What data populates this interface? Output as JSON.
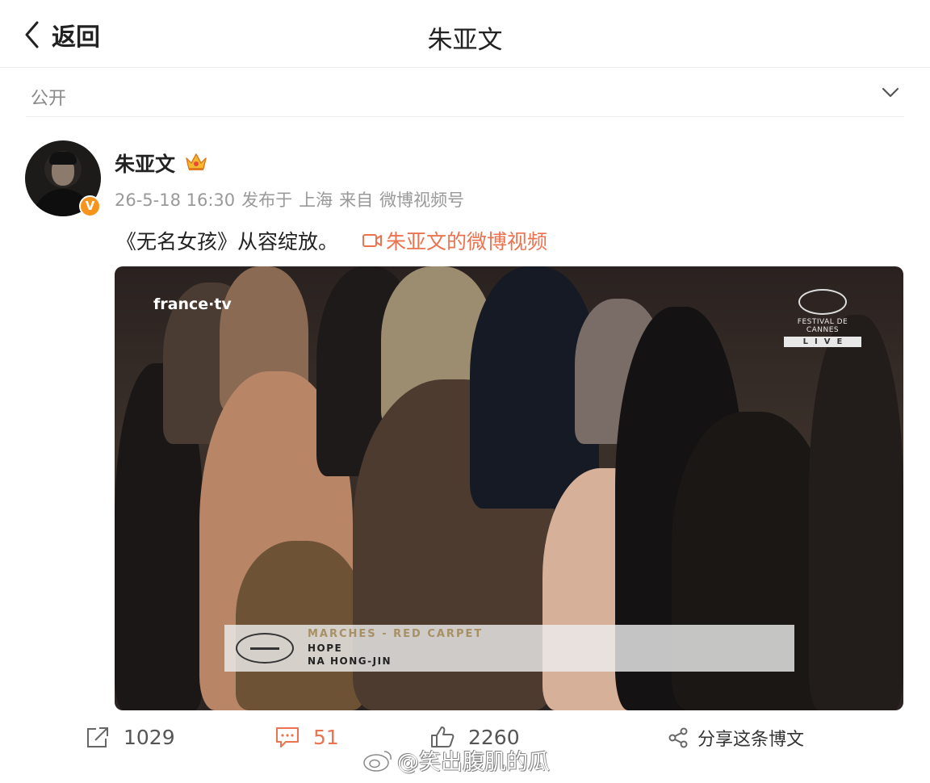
{
  "header": {
    "back_label": "返回",
    "title": "朱亚文"
  },
  "visibility": {
    "label": "公开"
  },
  "post": {
    "author": "朱亚文",
    "verified_badge": "V",
    "timestamp": "26-5-18 16:30",
    "location_prefix": "发布于",
    "location": "上海",
    "source_prefix": "来自",
    "source": "微博视频号",
    "text": "《无名女孩》从容绽放。",
    "video_link_label": "朱亚文的微博视频"
  },
  "video": {
    "channel_logo": "france·tv",
    "festival_name": "FESTIVAL DE CANNES",
    "festival_live": "LIVE",
    "lower_third_line1": "MARCHES - RED CARPET",
    "lower_third_line2": "HOPE",
    "lower_third_line3": "NA HONG-JIN"
  },
  "actions": {
    "repost_count": "1029",
    "comment_count": "51",
    "like_count": "2260",
    "share_label": "分享这条博文"
  },
  "watermark": {
    "text": "@笑出腹肌的瓜"
  },
  "colors": {
    "accent": "#eb7350",
    "verified": "#f7941d",
    "muted_text": "#999999"
  },
  "icons": [
    "back-chevron-icon",
    "chevron-down-icon",
    "crown-icon",
    "video-icon",
    "repost-icon",
    "comment-icon",
    "like-icon",
    "share-icon",
    "weibo-logo-icon"
  ]
}
